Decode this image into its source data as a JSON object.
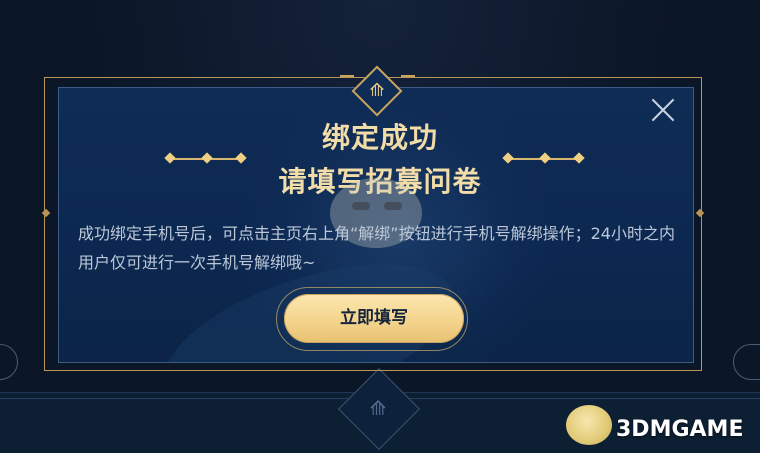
{
  "modal": {
    "title_line1": "绑定成功",
    "title_line2": "请填写招募问卷",
    "description": "成功绑定手机号后，可点击主页右上角“解绑”按钮进行手机号解绑操作；24小时之内用户仅可进行一次手机号解绑哦~",
    "primary_button_label": "立即填写",
    "close_icon": "close-icon",
    "emblem_icon": "game-emblem-icon"
  },
  "watermark": {
    "text": "3DMGAME"
  },
  "colors": {
    "accent_gold": "#f2dca8",
    "button_fill": "#f4d48c",
    "modal_bg": "#0f2c55",
    "page_bg": "#0b1626"
  }
}
